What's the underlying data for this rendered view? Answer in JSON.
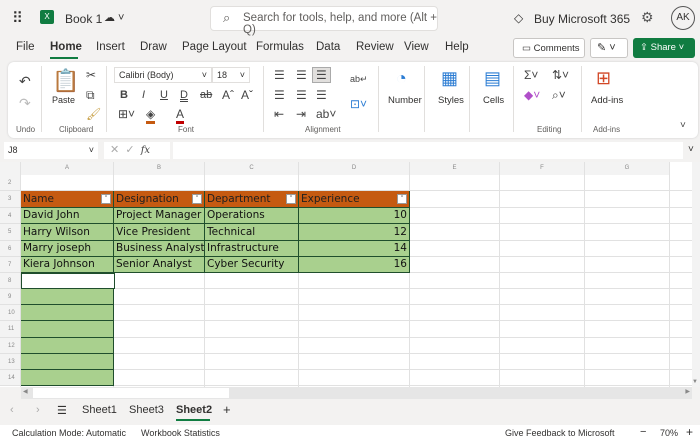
{
  "app": {
    "title": "Book 1",
    "search_placeholder": "Search for tools, help, and more (Alt + Q)",
    "buy": "Buy Microsoft 365",
    "avatar": "AK"
  },
  "menu": [
    "File",
    "Home",
    "Insert",
    "Draw",
    "Page Layout",
    "Formulas",
    "Data",
    "Review",
    "View",
    "Help"
  ],
  "actions": {
    "comments": "Comments",
    "share": "Share"
  },
  "ribbon": {
    "font_name": "Calibri (Body)",
    "font_size": "18",
    "paste": "Paste",
    "number": "Number",
    "styles": "Styles",
    "cells": "Cells",
    "addins": "Add-ins",
    "groups": {
      "undo": "Undo",
      "clipboard": "Clipboard",
      "font": "Font",
      "alignment": "Alignment",
      "editing": "Editing",
      "addins": "Add-ins"
    }
  },
  "formula_bar": {
    "name_box": "J8",
    "fx": "fx",
    "value": ""
  },
  "columns": [
    "A",
    "B",
    "C",
    "D",
    "E",
    "F",
    "G"
  ],
  "rows": [
    "2",
    "3",
    "4",
    "5",
    "6",
    "7",
    "8",
    "9",
    "10",
    "11",
    "12",
    "13",
    "14"
  ],
  "table": {
    "headers": [
      "Name",
      "Designation",
      "Department",
      "Experience"
    ],
    "rows": [
      [
        "David John",
        "Project Manager",
        "Operations",
        "10"
      ],
      [
        "Harry Wilson",
        "Vice President",
        "Technical",
        "12"
      ],
      [
        "Marry joseph",
        "Business Analyst",
        "Infrastructure",
        "14"
      ],
      [
        "Kiera Johnson",
        "Senior Analyst",
        "Cyber Security",
        "16"
      ]
    ]
  },
  "colors": {
    "header_fill": "#c55a11",
    "body_fill": "#a9d08e",
    "accent": "#107c41"
  },
  "sheets": [
    "Sheet1",
    "Sheet3",
    "Sheet2"
  ],
  "active_sheet": "Sheet2",
  "status": {
    "calc": "Calculation Mode: Automatic",
    "stats": "Workbook Statistics",
    "feedback": "Give Feedback to Microsoft",
    "zoom": "70%"
  }
}
